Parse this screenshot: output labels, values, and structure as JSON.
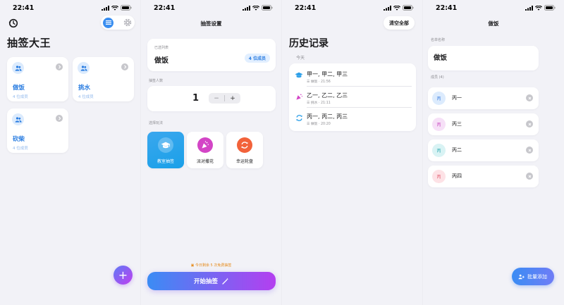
{
  "status_bar": {
    "time": "22:41"
  },
  "groups_screen": {
    "title": "抽签大王",
    "groups": [
      {
        "name": "做饭",
        "count": "4 位成员"
      },
      {
        "name": "挑水",
        "count": "4 位成员"
      },
      {
        "name": "砍柴",
        "count": "4 位成员"
      }
    ],
    "fab": "+"
  },
  "settings_screen": {
    "nav_title": "抽签设置",
    "list_section_label": "已选列表",
    "list_name": "做饭",
    "member_badge": "4 位成员",
    "count_section_label": "抽签人数",
    "count_value": "1",
    "minus": "−",
    "plus": "+",
    "mode_section_label": "选择玩法",
    "modes": [
      {
        "label": "教室抽签",
        "active": true
      },
      {
        "label": "派对撒花",
        "active": false
      },
      {
        "label": "幸运轮盘",
        "active": false
      }
    ],
    "free_notice": "今日剩余 5 次免费抽签",
    "start_button": "开始抽签"
  },
  "history_screen": {
    "clear_button": "清空全部",
    "title": "历史记录",
    "section": "今天",
    "records": [
      {
        "names": "甲一, 甲二, 甲三",
        "meta": "做饭 · 21:56",
        "icon": "graduation-cap-icon",
        "color": "#2a9ee8"
      },
      {
        "names": "乙一, 乙二, 乙三",
        "meta": "挑水 · 21:11",
        "icon": "party-popper-icon",
        "color": "#d345c6"
      },
      {
        "names": "丙一, 丙二, 丙三",
        "meta": "做饭 · 20:20",
        "icon": "wheel-icon",
        "color": "#2a9ee8"
      }
    ]
  },
  "edit_screen": {
    "nav_title": "做饭",
    "name_label": "名单名称",
    "name_value": "做饭",
    "members_label": "成员 (4)",
    "members": [
      {
        "avatar": "丙",
        "name": "丙一",
        "bg": "#dcebfd",
        "fg": "#3a7de0"
      },
      {
        "avatar": "丙",
        "name": "丙三",
        "bg": "#f6e0f7",
        "fg": "#c948c0"
      },
      {
        "avatar": "丙",
        "name": "丙二",
        "bg": "#d9f3f4",
        "fg": "#2aa7b0"
      },
      {
        "avatar": "丙",
        "name": "丙四",
        "bg": "#fde2e6",
        "fg": "#e25b6e"
      }
    ],
    "batch_button": "批量添加"
  }
}
